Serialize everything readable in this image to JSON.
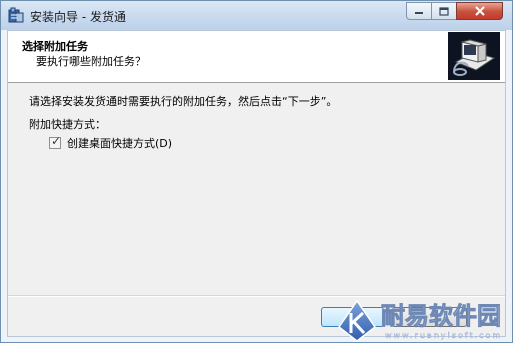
{
  "window": {
    "title": "安装向导 - 发货通",
    "minimize_icon": "minimize-icon",
    "maximize_icon": "maximize-icon",
    "close_icon": "close-icon"
  },
  "header": {
    "title": "选择附加任务",
    "subtitle": "要执行哪些附加任务？"
  },
  "content": {
    "intro": "请选择安装发货通时需要执行的附加任务，然后点击“下一步”。",
    "group_label": "附加快捷方式：",
    "checkbox": {
      "label": "创建桌面快捷方式(D)",
      "checked": true
    }
  },
  "watermark": {
    "text": "耐易软件园",
    "sub": "www.ruanyisoft.com"
  }
}
